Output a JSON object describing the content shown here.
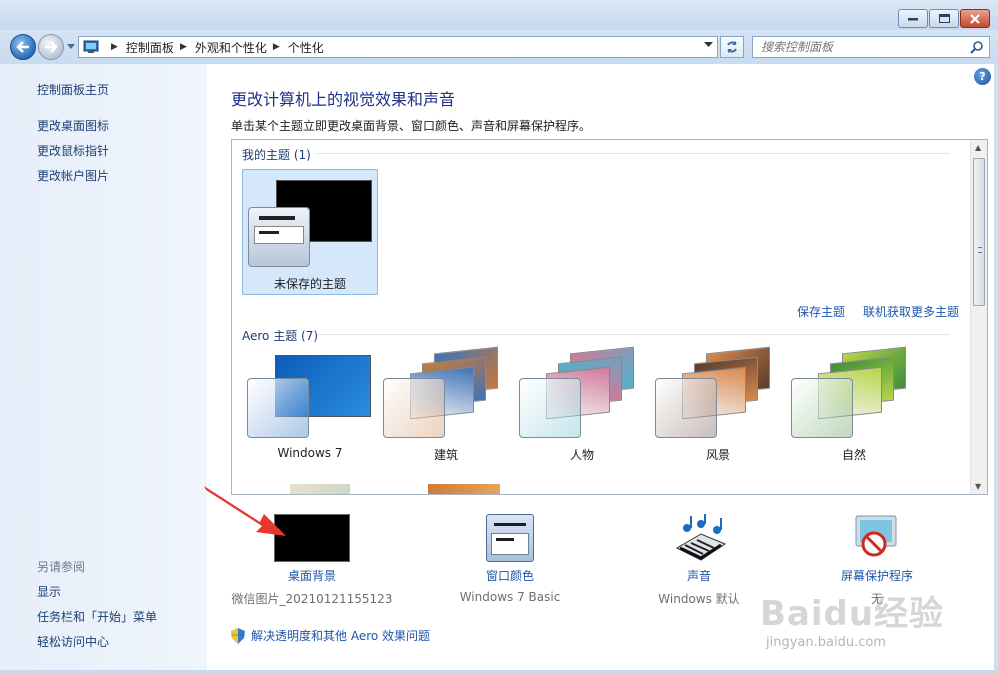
{
  "window": {
    "controls": {
      "minimize": "minimize",
      "maximize": "maximize",
      "close": "close"
    }
  },
  "addressbar": {
    "crumbs": [
      "控制面板",
      "外观和个性化",
      "个性化"
    ],
    "search_placeholder": "搜索控制面板"
  },
  "sidebar": {
    "home": "控制面板主页",
    "links": [
      "更改桌面图标",
      "更改鼠标指针",
      "更改帐户图片"
    ],
    "see_also_heading": "另请参阅",
    "see_also": [
      "显示",
      "任务栏和「开始」菜单",
      "轻松访问中心"
    ]
  },
  "main": {
    "title": "更改计算机上的视觉效果和声音",
    "subtitle": "单击某个主题立即更改桌面背景、窗口颜色、声音和屏幕保护程序。",
    "my_themes": {
      "label": "我的主题 (1)",
      "items": [
        {
          "name": "未保存的主题",
          "selected": true
        }
      ],
      "save_link": "保存主题",
      "online_link": "联机获取更多主题"
    },
    "aero_themes": {
      "label": "Aero 主题 (7)",
      "items": [
        {
          "name": "Windows 7",
          "colors": [
            "#0b5cb8",
            "#2a8ee0"
          ]
        },
        {
          "name": "建筑",
          "colors": [
            "#c67a3c",
            "#3e72b8"
          ]
        },
        {
          "name": "人物",
          "colors": [
            "#4fb2c9",
            "#d0799a"
          ]
        },
        {
          "name": "风景",
          "colors": [
            "#5a3b2e",
            "#d9894e"
          ]
        },
        {
          "name": "自然",
          "colors": [
            "#3f8e3a",
            "#b7d54a"
          ]
        }
      ]
    },
    "settings": {
      "desktop_background": {
        "label": "桌面背景",
        "value": "微信图片_20210121155123"
      },
      "window_color": {
        "label": "窗口颜色",
        "value": "Windows 7 Basic"
      },
      "sounds": {
        "label": "声音",
        "value": "Windows 默认"
      },
      "screen_saver": {
        "label": "屏幕保护程序",
        "value": "无"
      }
    },
    "troubleshoot": "解决透明度和其他 Aero 效果问题"
  },
  "watermark": {
    "text": "Baidu经验",
    "url_text": "jingyan.baidu.com"
  },
  "colors": {
    "link": "#1e56a8",
    "title": "#1e3287",
    "annotation_arrow": "#e8362a"
  }
}
